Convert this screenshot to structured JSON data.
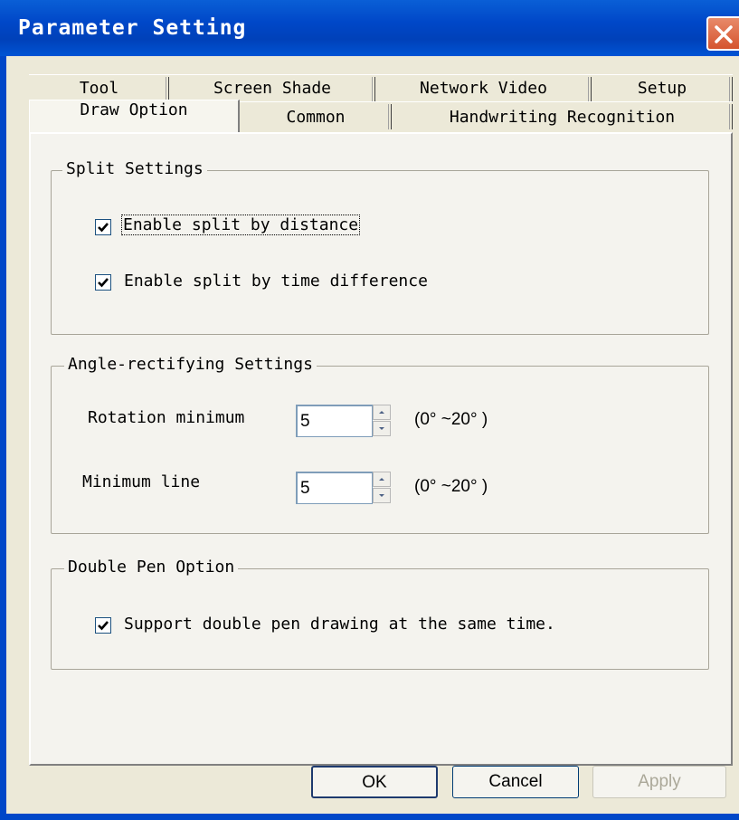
{
  "window": {
    "title": "Parameter Setting"
  },
  "tabs_back": [
    {
      "label": "Tool"
    },
    {
      "label": "Screen Shade"
    },
    {
      "label": "Network Video"
    },
    {
      "label": "Setup"
    }
  ],
  "tabs_front": [
    {
      "label": "Draw Option",
      "active": true
    },
    {
      "label": "Common"
    },
    {
      "label": "Handwriting Recognition"
    }
  ],
  "split": {
    "title": "Split Settings",
    "distance_label": "Enable split by distance",
    "distance_checked": true,
    "time_label": "Enable split by time difference",
    "time_checked": true
  },
  "angle": {
    "title": "Angle-rectifying Settings",
    "rotation_label": "Rotation minimum",
    "rotation_value": "5",
    "rotation_range": "(0° ~20° )",
    "minline_label": "Minimum line",
    "minline_value": "5",
    "minline_range": "(0° ~20° )"
  },
  "pen": {
    "title": "Double Pen Option",
    "support_label": "Support double pen drawing at the same time.",
    "support_checked": true
  },
  "buttons": {
    "ok": "OK",
    "cancel": "Cancel",
    "apply": "Apply"
  }
}
